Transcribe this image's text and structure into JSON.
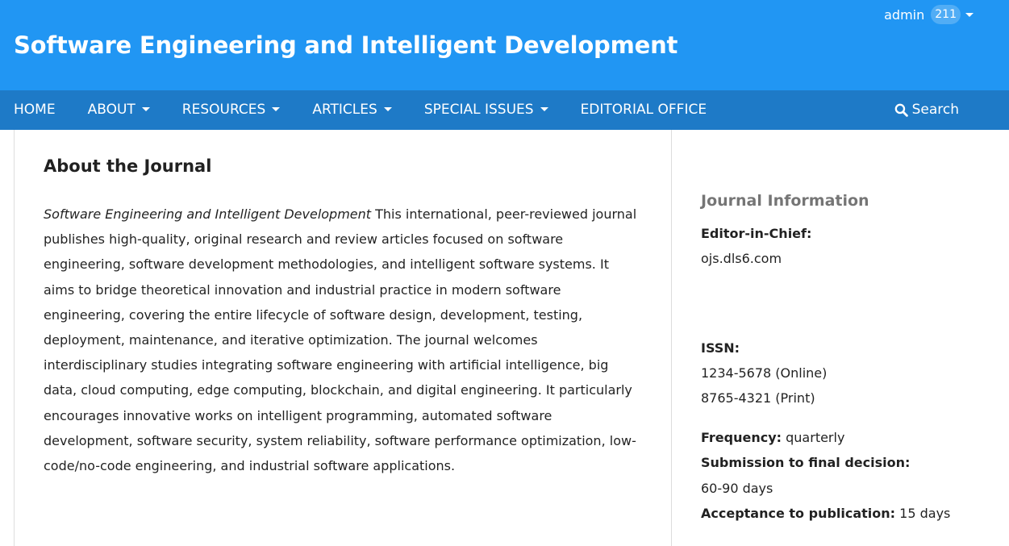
{
  "header": {
    "site_title": "Software Engineering and Intelligent Development",
    "user": {
      "name": "admin",
      "badge_count": "211"
    }
  },
  "nav": {
    "items": [
      {
        "label": "HOME",
        "has_dropdown": false
      },
      {
        "label": "ABOUT",
        "has_dropdown": true
      },
      {
        "label": "RESOURCES",
        "has_dropdown": true
      },
      {
        "label": "ARTICLES",
        "has_dropdown": true
      },
      {
        "label": "SPECIAL ISSUES",
        "has_dropdown": true
      },
      {
        "label": "EDITORIAL OFFICE",
        "has_dropdown": false
      }
    ],
    "search_label": "Search"
  },
  "main": {
    "title": "About the Journal",
    "journal_name_italic": "Software Engineering and Intelligent Development",
    "description": " This international, peer-reviewed journal publishes high-quality, original research and review articles focused on software engineering, software development methodologies, and intelligent software systems. It aims to bridge theoretical innovation and industrial practice in modern software engineering, covering the entire lifecycle of software design, development, testing, deployment, maintenance, and iterative optimization. The journal welcomes interdisciplinary studies integrating software engineering with artificial intelligence, big data, cloud computing, edge computing, blockchain, and digital engineering. It particularly encourages innovative works on intelligent programming, automated software development, software security, system reliability, software performance optimization, low-code/no-code engineering, and industrial software applications."
  },
  "sidebar": {
    "heading": "Journal Information",
    "editor_label": "Editor-in-Chief:",
    "editor_value": "ojs.dls6.com",
    "issn_label": "ISSN:",
    "issn_online": "1234-5678 (Online)",
    "issn_print": "8765-4321 (Print)",
    "frequency_label": "Frequency:",
    "frequency_value": " quarterly",
    "submission_label": "Submission to final decision:",
    "submission_value": "60-90 days",
    "acceptance_label": "Acceptance to publication:",
    "acceptance_value": " 15 days"
  },
  "colors": {
    "header_bg": "#2196f3",
    "nav_bg": "#1e7ac7"
  },
  "icons": {
    "search": "search-icon",
    "dropdown": "caret-down-icon"
  }
}
